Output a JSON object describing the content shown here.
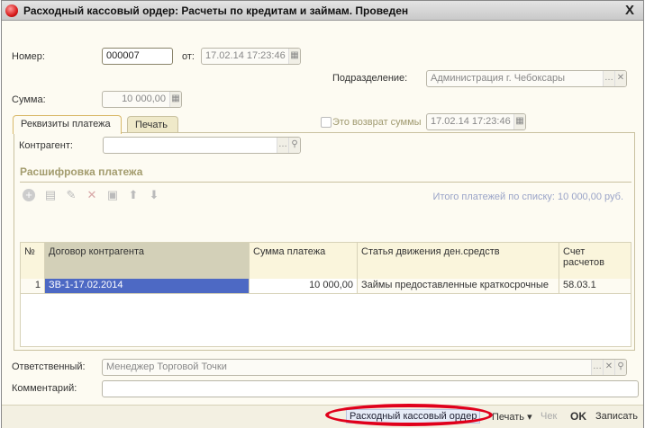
{
  "window": {
    "title": "Расходный кассовый ордер: Расчеты по кредитам и займам. Проведен",
    "close": "X"
  },
  "form": {
    "number_label": "Номер:",
    "number": "000007",
    "date_label": "от:",
    "date": "17.02.14 17:23:46",
    "division_label": "Подразделение:",
    "division": "Администрация г. Чебоксары",
    "sum_label": "Сумма:",
    "sum": "10 000,00",
    "return_label": "Это возврат суммы",
    "return_date": "17.02.14 17:23:46",
    "responsible_label": "Ответственный:",
    "responsible": "Менеджер Торговой Точки",
    "comment_label": "Комментарий:",
    "comment": ""
  },
  "tabs": [
    {
      "label": "Реквизиты платежа"
    },
    {
      "label": "Печать"
    }
  ],
  "payment": {
    "counterparty_label": "Контрагент:",
    "counterparty": "",
    "section_title": "Расшифровка платежа",
    "total": "Итого платежей по списку: 10 000,00 руб.",
    "columns": [
      "№",
      "Договор контрагента",
      "Сумма платежа",
      "Статья движения ден.средств",
      "Счет расчетов"
    ],
    "rows": [
      [
        "1",
        "ЗВ-1-17.02.2014",
        "10 000,00",
        "Займы предоставленные краткосрочные",
        "58.03.1"
      ]
    ]
  },
  "footer": {
    "rko": "Расходный кассовый ордер",
    "print": "Печать ▾",
    "check": "Чек",
    "ok": "OK",
    "save": "Записать"
  },
  "colors": {
    "selection": "#4d69c4",
    "highlight": "#e0001b"
  }
}
